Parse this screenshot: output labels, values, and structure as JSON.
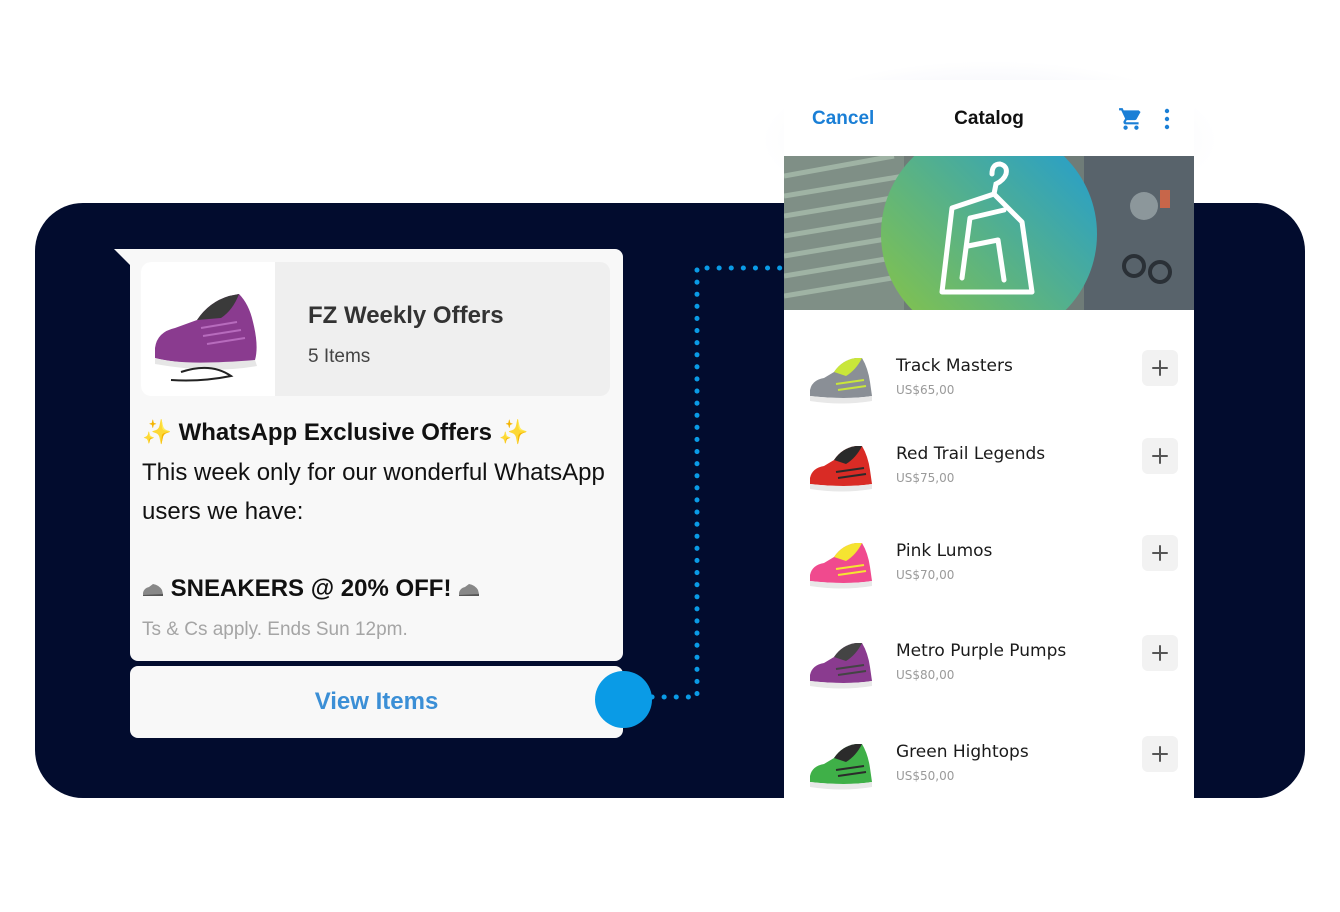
{
  "chat": {
    "catalog_card": {
      "title": "FZ Weekly Offers",
      "count": "5 Items"
    },
    "message": {
      "sparkle": "✨",
      "headline": "WhatsApp Exclusive Offers",
      "line1": "This week only for our wonderful WhatsApp",
      "line2": "users we have:",
      "promo": "SNEAKERS @ 20% OFF!",
      "terms": "Ts & Cs apply. Ends Sun 12pm."
    },
    "view_items_label": "View Items"
  },
  "catalog": {
    "cancel_label": "Cancel",
    "title": "Catalog",
    "items": [
      {
        "name": "Track Masters",
        "price": "US$65,00",
        "color": "#8a8f96",
        "accent": "#c9e63a"
      },
      {
        "name": "Red Trail Legends",
        "price": "US$75,00",
        "color": "#d92b25",
        "accent": "#2a2a2a"
      },
      {
        "name": "Pink Lumos",
        "price": "US$70,00",
        "color": "#f04a8e",
        "accent": "#f5e431"
      },
      {
        "name": "Metro Purple Pumps",
        "price": "US$80,00",
        "color": "#8a3b8f",
        "accent": "#444444"
      },
      {
        "name": "Green Hightops",
        "price": "US$50,00",
        "color": "#3fb048",
        "accent": "#2b2b2b"
      }
    ]
  },
  "colors": {
    "backdrop": "#020c2e",
    "accent_blue": "#1a7fd6",
    "connector": "#0a9be6"
  },
  "icons": [
    "sneaker-icon",
    "sparkle-icon",
    "cart-icon",
    "more-vertical-icon",
    "plus-icon",
    "hanger-logo-icon"
  ]
}
